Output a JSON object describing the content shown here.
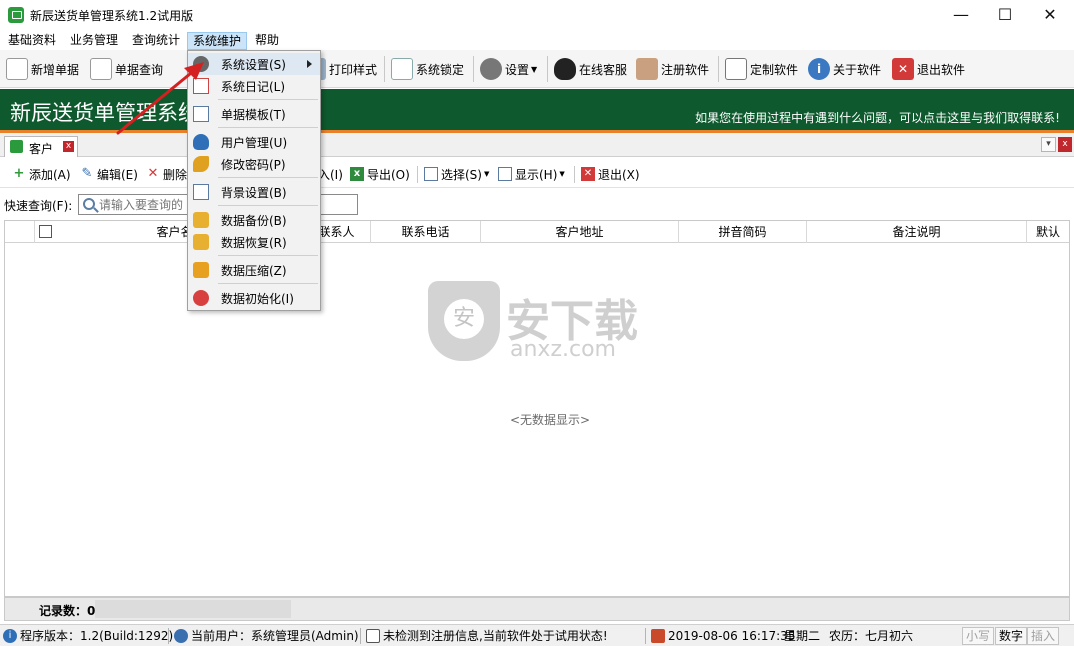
{
  "window": {
    "title": "新辰送货单管理系统1.2试用版",
    "minimize": "—",
    "maximize": "☐",
    "close": "✕"
  },
  "menubar": [
    {
      "label": "基础资料"
    },
    {
      "label": "业务管理"
    },
    {
      "label": "查询统计"
    },
    {
      "label": "系统维护",
      "active": true
    },
    {
      "label": "帮助"
    }
  ],
  "toolbar": {
    "new_order": "新增单据",
    "order_query": "单据查询",
    "print_style": "打印样式",
    "system_lock": "系统锁定",
    "settings": "设置",
    "online_service": "在线客服",
    "register": "注册软件",
    "custom": "定制软件",
    "about": "关于软件",
    "exit": "退出软件"
  },
  "banner": {
    "title": "新辰送货单管理系统",
    "help_text": "如果您在使用过程中有遇到什么问题，可以点击这里与我们取得联系!"
  },
  "doc_tab": {
    "label": "客户",
    "close": "x"
  },
  "subtoolbar": {
    "add": "添加(A)",
    "edit": "编辑(E)",
    "delete": "删除",
    "import_suffix": "入(I)",
    "export": "导出(O)",
    "select": "选择(S)",
    "display": "显示(H)",
    "exit": "退出(X)"
  },
  "search": {
    "label": "快速查询(F):",
    "placeholder": "请输入要查询的"
  },
  "grid": {
    "columns": [
      "客户名称",
      "联系人",
      "联系电话",
      "客户地址",
      "拼音简码",
      "备注说明",
      "默认"
    ],
    "empty_text": "<无数据显示>"
  },
  "watermark": {
    "cn": "安下载",
    "en": "anxz.com"
  },
  "footer": {
    "record_count": "记录数：0"
  },
  "statusbar": {
    "version": "程序版本：1.2(Build:1292)",
    "user": "当前用户：系统管理员(Admin)",
    "reg_status": "未检测到注册信息,当前软件处于试用状态!",
    "datetime": "2019-08-06 16:17:35",
    "weekday": "星期二",
    "lunar": "农历：七月初六",
    "key_lower": "小写",
    "key_num": "数字",
    "key_ins": "插入"
  },
  "dropdown": {
    "items": [
      {
        "label": "系统设置(S)",
        "icon": "gear-icon",
        "submenu": true
      },
      {
        "label": "系统日记(L)",
        "icon": "log-icon"
      },
      {
        "label": "单据模板(T)",
        "icon": "template-icon"
      },
      {
        "label": "用户管理(U)",
        "icon": "user-icon"
      },
      {
        "label": "修改密码(P)",
        "icon": "key-icon"
      },
      {
        "label": "背景设置(B)",
        "icon": "background-icon"
      },
      {
        "label": "数据备份(B)",
        "icon": "backup-icon"
      },
      {
        "label": "数据恢复(R)",
        "icon": "restore-icon"
      },
      {
        "label": "数据压缩(Z)",
        "icon": "compress-icon"
      },
      {
        "label": "数据初始化(I)",
        "icon": "init-icon"
      }
    ]
  },
  "colors": {
    "banner": "#0e5a2e",
    "accent_line": "#e8812a",
    "arrow": "#d42020"
  }
}
